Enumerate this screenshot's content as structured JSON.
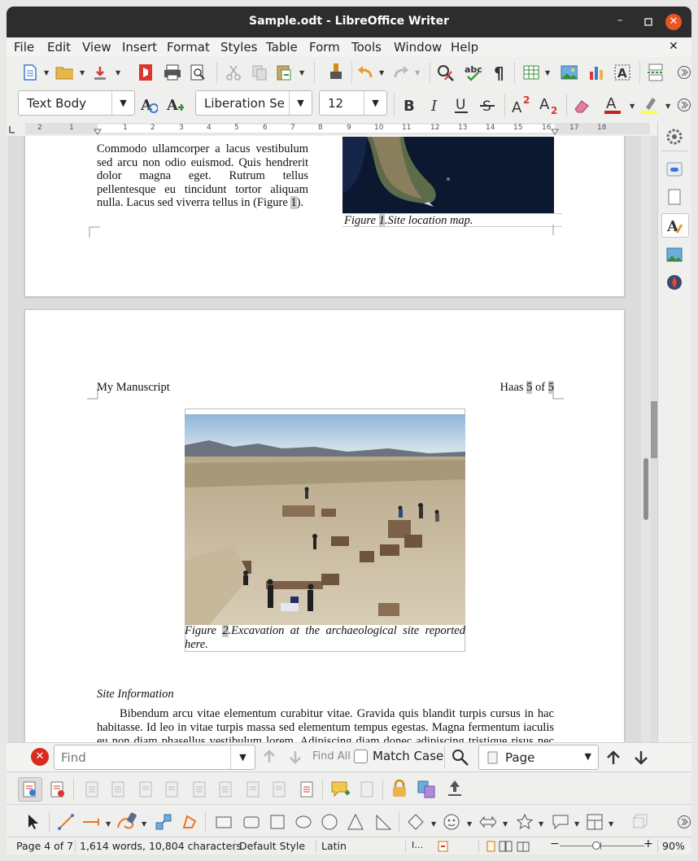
{
  "window": {
    "title": "Sample.odt - LibreOffice Writer"
  },
  "menu": [
    "File",
    "Edit",
    "View",
    "Insert",
    "Format",
    "Styles",
    "Table",
    "Form",
    "Tools",
    "Window",
    "Help"
  ],
  "format_bar": {
    "para_style": "Text Body",
    "font_name": "Liberation Se",
    "font_size": "12"
  },
  "ruler": {
    "ticks": [
      "2",
      "1",
      "1",
      "2",
      "3",
      "4",
      "5",
      "6",
      "7",
      "8",
      "9",
      "10",
      "11",
      "12",
      "13",
      "14",
      "15",
      "16",
      "17",
      "18"
    ]
  },
  "page1": {
    "body_lines": [
      "Commodo ullamcorper a lacus vestibulum",
      "sed arcu non odio euismod. Quis hendrerit",
      "dolor magna eget. Rutrum tellus",
      "pellentesque eu tincidunt tortor aliquam"
    ],
    "last_line_pre": "nulla. Lacus sed viverra tellus in (Figure ",
    "last_line_ref": "1",
    "last_line_post": ").",
    "caption_pre": "Figure ",
    "caption_num": "1",
    "caption_post": ".Site location map."
  },
  "page2": {
    "header_left": "My Manuscript",
    "header_right_pre": "Haas ",
    "header_page": "5",
    "header_of": " of ",
    "header_total": "5",
    "caption_pre": "Figure ",
    "caption_num": "2",
    "caption_line1": ".Excavation at the archaeological site reported",
    "caption_line2": "here.",
    "section_heading": "Site Information",
    "para_line1": "Bibendum arcu vitae elementum curabitur vitae. Gravida quis blandit turpis cursus in hac",
    "para_line2": "habitasse. Id leo in vitae turpis massa sed elementum tempus egestas. Magna fermentum iaculis",
    "para_line3": "eu non diam phasellus vestibulum lorem. Adipiscing diam donec adipiscing tristique risus nec"
  },
  "find": {
    "placeholder": "Find",
    "find_all": "Find All",
    "match_case": "Match Case",
    "search_scope": "Page"
  },
  "status": {
    "page": "Page 4 of 7",
    "words": "1,614 words, 10,804 characters",
    "style": "Default Style",
    "language": "Latin",
    "zoom": "90%"
  },
  "colors": {
    "accent": "#e95420",
    "highlight": "#ffff38",
    "font_color": "#c9211e"
  }
}
